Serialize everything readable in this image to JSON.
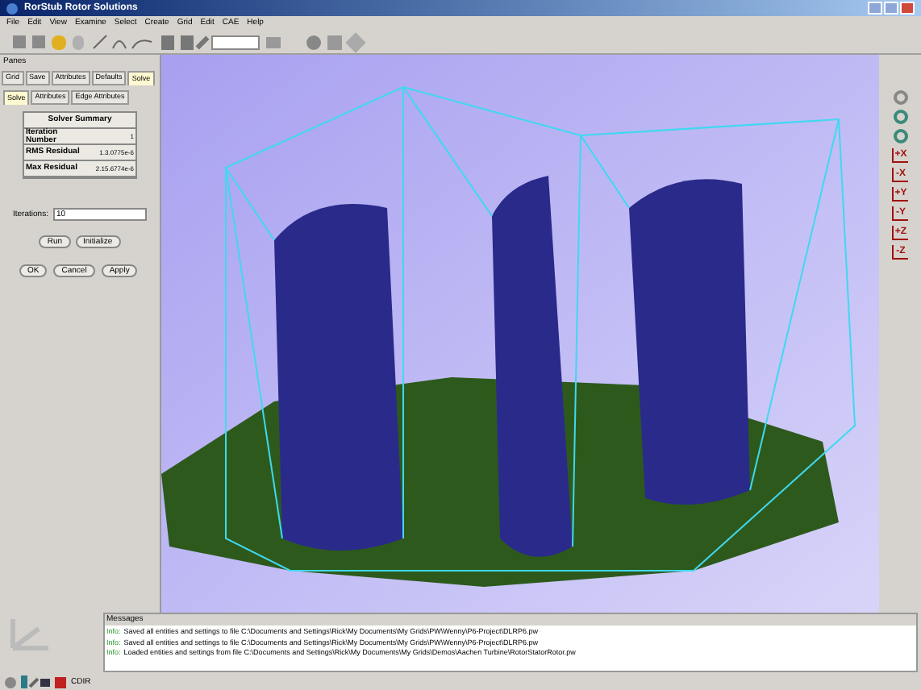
{
  "window": {
    "title": "RorStub Rotor Solutions"
  },
  "menu": [
    "File",
    "Edit",
    "View",
    "Examine",
    "Select",
    "Create",
    "Grid",
    "Edit",
    "CAE",
    "Help"
  ],
  "panes": {
    "title": "Panes",
    "tabs": [
      {
        "label": "Grid",
        "selected": false
      },
      {
        "label": "Save",
        "selected": false
      },
      {
        "label": "Attributes",
        "selected": false
      },
      {
        "label": "Defaults",
        "selected": false
      },
      {
        "label": "Solve",
        "selected": true
      }
    ],
    "subtabs": [
      {
        "label": "Solve",
        "selected": true
      },
      {
        "label": "Attributes",
        "selected": false
      },
      {
        "label": "Edge Attributes",
        "selected": false
      }
    ],
    "summary": {
      "title": "Solver Summary",
      "rows": [
        {
          "label": "Iteration Number",
          "value": "1"
        },
        {
          "label": "RMS Residual",
          "value": "1.3.0775e-6"
        },
        {
          "label": "Max Residual",
          "value": "2.15.6774e-6"
        }
      ]
    },
    "iterations": {
      "label": "Iterations:",
      "value": "10"
    },
    "actions": [
      "Run",
      "Initialize"
    ],
    "buttons": [
      "OK",
      "Cancel",
      "Apply"
    ]
  },
  "view_buttons": [
    "+X",
    "-X",
    "+Y",
    "-Y",
    "+Z",
    "-Z"
  ],
  "messages": {
    "title": "Messages",
    "lines": [
      {
        "prefix": "Info:",
        "text": "Saved all entities and settings to file C:\\Documents and Settings\\Rick\\My Documents\\My Grids\\PW\\Wenny\\P6-Project\\DLRP6.pw"
      },
      {
        "prefix": "Info:",
        "text": "Saved all entities and settings to file C:\\Documents and Settings\\Rick\\My Documents\\My Grids\\PW\\Wenny\\P6-Project\\DLRP6.pw"
      },
      {
        "prefix": "Info:",
        "text": "Loaded entities and settings from file C:\\Documents and Settings\\Rick\\My Documents\\My Grids\\Demos\\Aachen Turbine\\RotorStatorRotor.pw"
      }
    ]
  },
  "status": {
    "text": "CDIR"
  }
}
